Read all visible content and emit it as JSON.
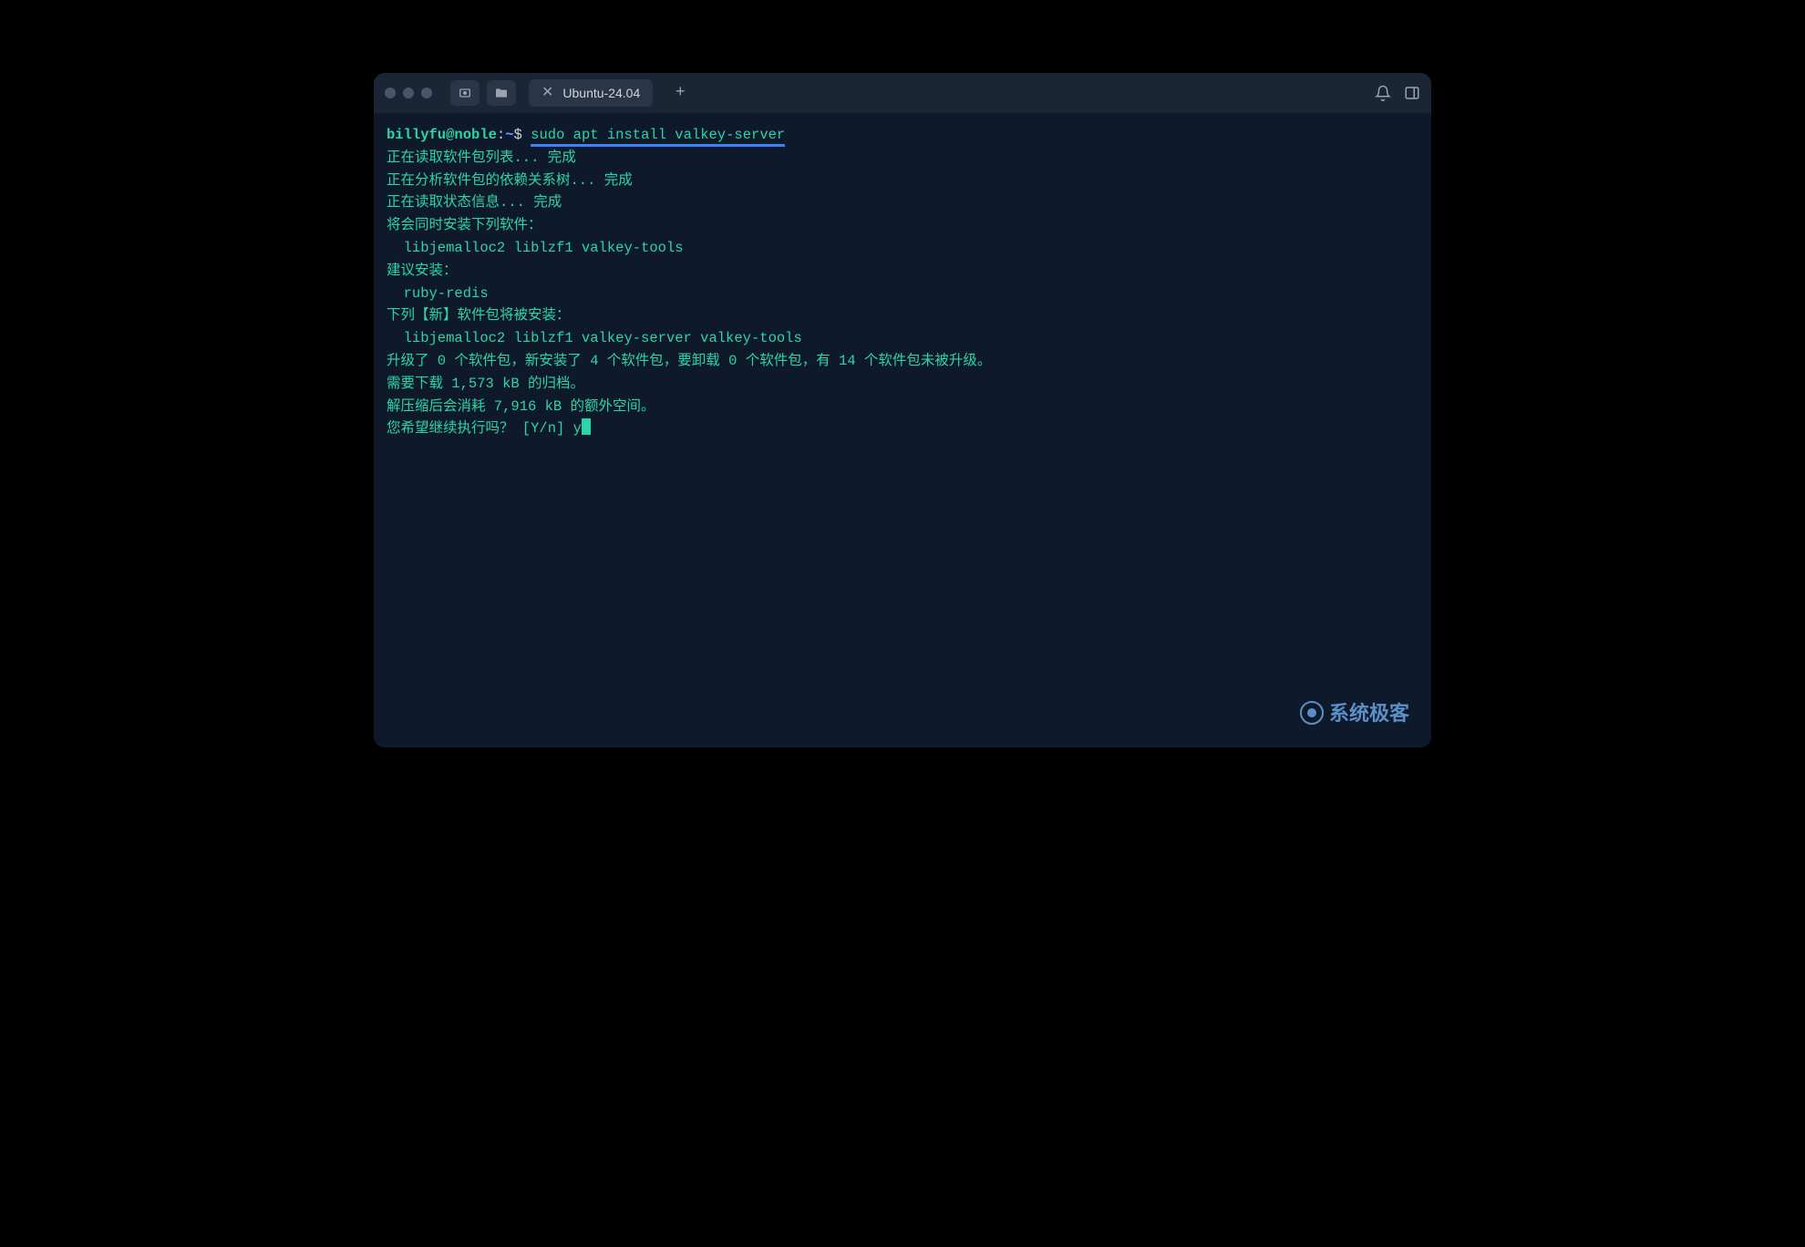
{
  "titlebar": {
    "tab_label": "Ubuntu-24.04"
  },
  "prompt": {
    "user_host": "billyfu@noble",
    "separator": ":",
    "path": "~",
    "symbol": "$",
    "command": "sudo apt install valkey-server"
  },
  "output": {
    "line1": "正在读取软件包列表... 完成",
    "line2": "正在分析软件包的依赖关系树... 完成",
    "line3": "正在读取状态信息... 完成",
    "line4": "将会同时安装下列软件：",
    "line5": "  libjemalloc2 liblzf1 valkey-tools",
    "line6": "建议安装：",
    "line7": "  ruby-redis",
    "line8": "下列【新】软件包将被安装：",
    "line9": "  libjemalloc2 liblzf1 valkey-server valkey-tools",
    "line10": "升级了 0 个软件包，新安装了 4 个软件包，要卸载 0 个软件包，有 14 个软件包未被升级。",
    "line11": "需要下载 1,573 kB 的归档。",
    "line12": "解压缩后会消耗 7,916 kB 的额外空间。",
    "line13_prompt": "您希望继续执行吗？ [Y/n] ",
    "line13_input": "y"
  },
  "watermark": {
    "text": "系统极客"
  }
}
